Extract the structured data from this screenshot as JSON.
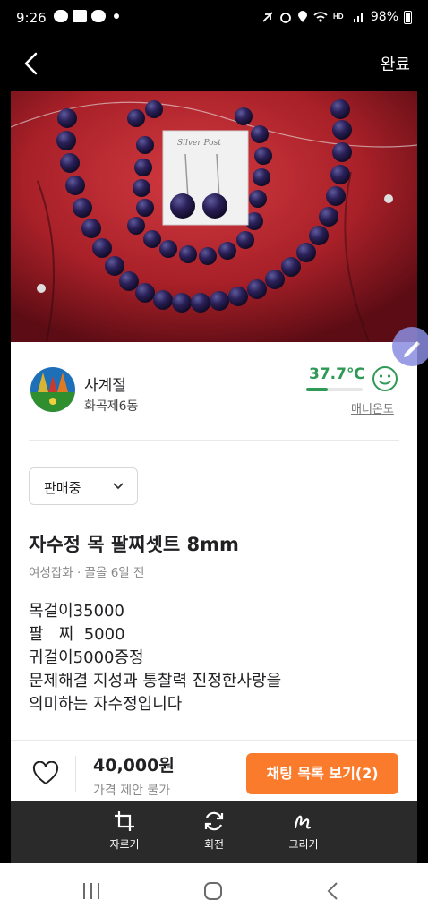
{
  "status_bar": {
    "time": "9:26",
    "notif_labels": [
      "TALK",
      "WON"
    ],
    "battery": "98%"
  },
  "top_bar": {
    "done_label": "완료"
  },
  "seller": {
    "name": "사계절",
    "location": "화곡제6동",
    "temperature": "37.7℃",
    "temperature_level": 0.377,
    "manner_label": "매너온도"
  },
  "listing": {
    "status": "판매중",
    "title": "자수정 목 팔찌셋트 8mm",
    "category": "여성잡화",
    "time_ago": " · 끌올 6일 전",
    "description": "목걸이35000\n팔   찌  5000\n귀걸이5000증정\n문제해결 지성과 통찰력 진정한사랑을\n의미하는 자수정입니다",
    "price": "40,000원",
    "negotiation": "가격 제안 불가",
    "chat_button": "채팅 목록 보기(2)"
  },
  "photo": {
    "tag_text": "Silver Post"
  },
  "tools": [
    {
      "label": "자르기",
      "icon": "crop-icon"
    },
    {
      "label": "회전",
      "icon": "rotate-icon"
    },
    {
      "label": "그리기",
      "icon": "draw-icon"
    }
  ],
  "colors": {
    "accent": "#fb7b2c",
    "temp_green": "#2e9a55"
  }
}
